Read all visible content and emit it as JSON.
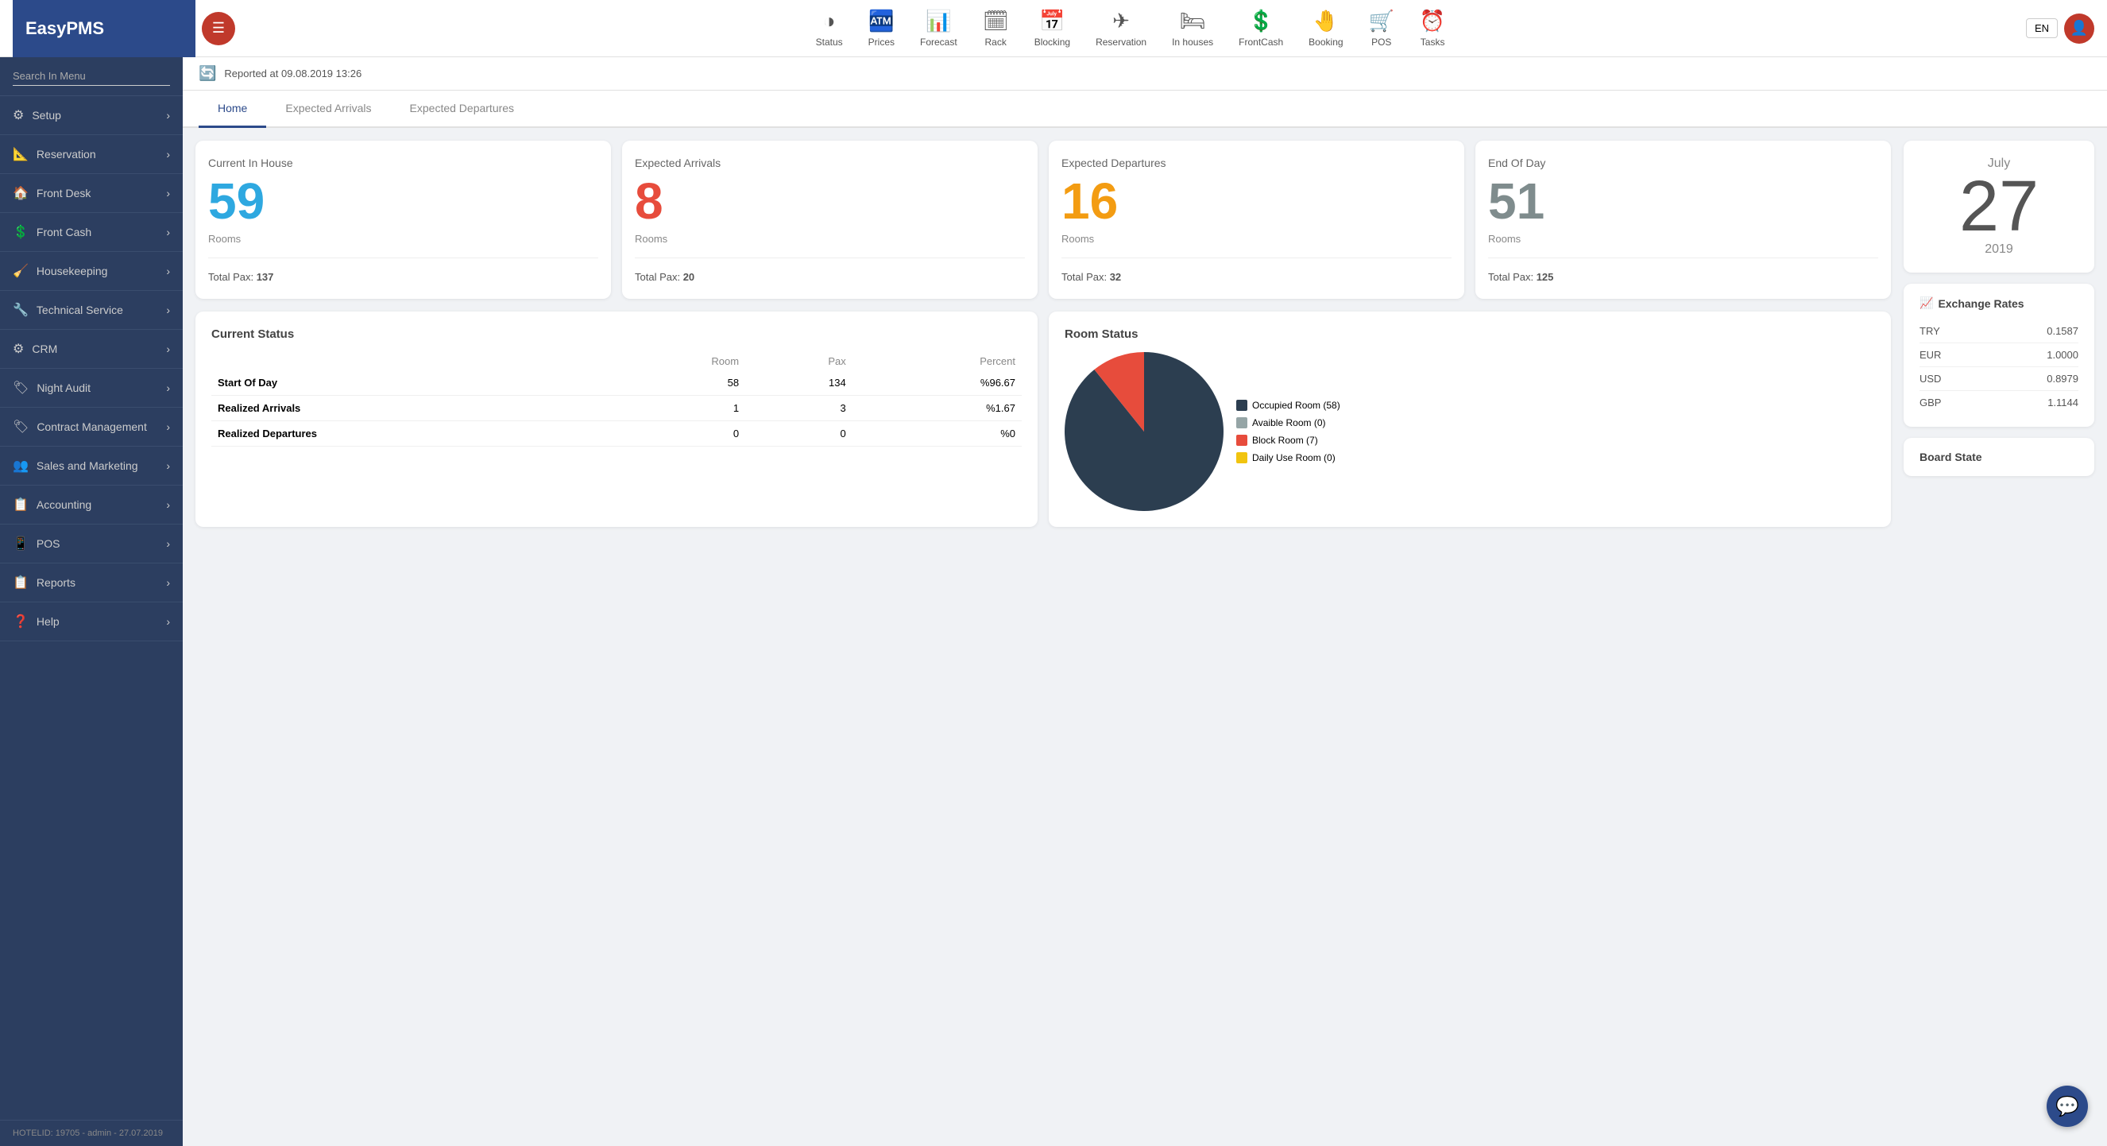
{
  "app": {
    "name": "EasyPMS",
    "lang": "EN",
    "hotel_id": "HOTELID: 19705 - admin - 27.07.2019"
  },
  "nav": {
    "items": [
      {
        "id": "status",
        "label": "Status",
        "icon": "◑"
      },
      {
        "id": "prices",
        "label": "Prices",
        "icon": "🏧"
      },
      {
        "id": "forecast",
        "label": "Forecast",
        "icon": "📊"
      },
      {
        "id": "rack",
        "label": "Rack",
        "icon": "🗓"
      },
      {
        "id": "blocking",
        "label": "Blocking",
        "icon": "📅"
      },
      {
        "id": "reservation",
        "label": "Reservation",
        "icon": "✈"
      },
      {
        "id": "inhouses",
        "label": "In houses",
        "icon": "🛏"
      },
      {
        "id": "frontcash",
        "label": "FrontCash",
        "icon": "💲"
      },
      {
        "id": "booking",
        "label": "Booking",
        "icon": "🤚"
      },
      {
        "id": "pos",
        "label": "POS",
        "icon": "🛒"
      },
      {
        "id": "tasks",
        "label": "Tasks",
        "icon": "⏰"
      }
    ]
  },
  "sidebar": {
    "search_placeholder": "Search In Menu",
    "items": [
      {
        "id": "setup",
        "label": "Setup",
        "icon": "⚙"
      },
      {
        "id": "reservation",
        "label": "Reservation",
        "icon": "📐"
      },
      {
        "id": "front-desk",
        "label": "Front Desk",
        "icon": "🏠"
      },
      {
        "id": "front-cash",
        "label": "Front Cash",
        "icon": "💲"
      },
      {
        "id": "housekeeping",
        "label": "Housekeeping",
        "icon": "🧹"
      },
      {
        "id": "technical-service",
        "label": "Technical Service",
        "icon": "🔧"
      },
      {
        "id": "crm",
        "label": "CRM",
        "icon": "⚙"
      },
      {
        "id": "night-audit",
        "label": "Night Audit",
        "icon": "🏷"
      },
      {
        "id": "contract-management",
        "label": "Contract Management",
        "icon": "🏷"
      },
      {
        "id": "sales-and-marketing",
        "label": "Sales and Marketing",
        "icon": "👥"
      },
      {
        "id": "accounting",
        "label": "Accounting",
        "icon": "📋"
      },
      {
        "id": "pos",
        "label": "POS",
        "icon": "📱"
      },
      {
        "id": "reports",
        "label": "Reports",
        "icon": "📋"
      },
      {
        "id": "help",
        "label": "Help",
        "icon": "❓"
      }
    ],
    "footer": "HOTELID: 19705 - admin - 27.07.2019"
  },
  "report": {
    "reported_at": "Reported at 09.08.2019 13:26"
  },
  "tabs": [
    {
      "id": "home",
      "label": "Home",
      "active": true
    },
    {
      "id": "expected-arrivals",
      "label": "Expected Arrivals",
      "active": false
    },
    {
      "id": "expected-departures",
      "label": "Expected Departures",
      "active": false
    }
  ],
  "stat_cards": [
    {
      "id": "current-in-house",
      "title": "Current In House",
      "number": "59",
      "number_color": "#2ea8e0",
      "unit": "Rooms",
      "pax_label": "Total Pax:",
      "pax_value": "137"
    },
    {
      "id": "expected-arrivals",
      "title": "Expected Arrivals",
      "number": "8",
      "number_color": "#e74c3c",
      "unit": "Rooms",
      "pax_label": "Total Pax:",
      "pax_value": "20"
    },
    {
      "id": "expected-departures",
      "title": "Expected Departures",
      "number": "16",
      "number_color": "#f39c12",
      "unit": "Rooms",
      "pax_label": "Total Pax:",
      "pax_value": "32"
    },
    {
      "id": "end-of-day",
      "title": "End Of Day",
      "number": "51",
      "number_color": "#7f8c8d",
      "unit": "Rooms",
      "pax_label": "Total Pax:",
      "pax_value": "125"
    }
  ],
  "current_status": {
    "title": "Current Status",
    "columns": [
      "",
      "Room",
      "Pax",
      "Percent"
    ],
    "rows": [
      {
        "label": "Start Of Day",
        "room": "58",
        "pax": "134",
        "percent": "%96.67",
        "bold": true
      },
      {
        "label": "Realized Arrivals",
        "room": "1",
        "pax": "3",
        "percent": "%1.67",
        "bold": false
      },
      {
        "label": "Realized Departures",
        "room": "0",
        "pax": "0",
        "percent": "%0",
        "bold": false
      }
    ]
  },
  "room_status": {
    "title": "Room Status",
    "legend": [
      {
        "label": "Occupied Room (58)",
        "color": "#2c3e50"
      },
      {
        "label": "Avaible Room (0)",
        "color": "#95a5a6"
      },
      {
        "label": "Block Room (7)",
        "color": "#e74c3c"
      },
      {
        "label": "Daily Use Room (0)",
        "color": "#f1c40f"
      }
    ],
    "pie_segments": [
      {
        "label": "Occupied",
        "value": 58,
        "color": "#2c3e50"
      },
      {
        "label": "Available",
        "value": 0,
        "color": "#95a5a6"
      },
      {
        "label": "Block",
        "value": 7,
        "color": "#e74c3c"
      },
      {
        "label": "Daily",
        "value": 0,
        "color": "#f1c40f"
      }
    ]
  },
  "date_card": {
    "month": "July",
    "day": "27",
    "year": "2019"
  },
  "exchange_rates": {
    "title": "Exchange Rates",
    "rates": [
      {
        "currency": "TRY",
        "value": "0.1587"
      },
      {
        "currency": "EUR",
        "value": "1.0000"
      },
      {
        "currency": "USD",
        "value": "0.8979"
      },
      {
        "currency": "GBP",
        "value": "1.1144"
      }
    ]
  },
  "board_state": {
    "title": "Board State"
  }
}
